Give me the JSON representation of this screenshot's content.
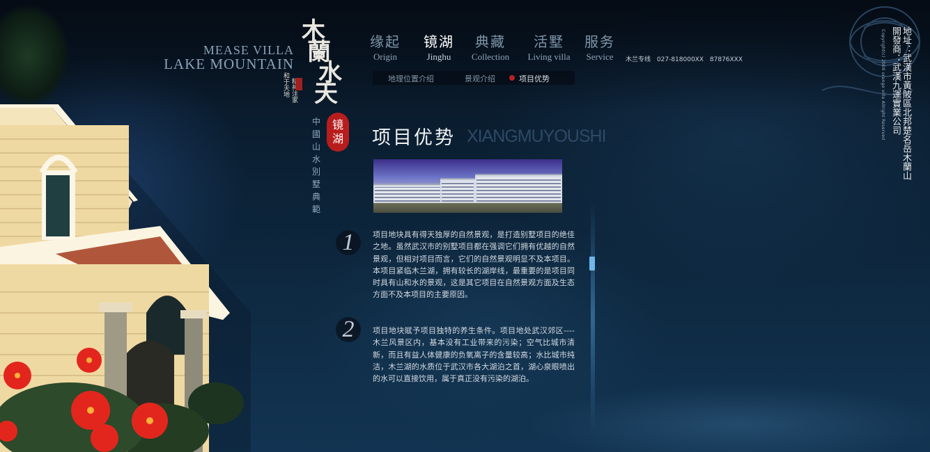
{
  "brand": {
    "en_line1": "MEASE VILLA",
    "en_line2": "LAKE MOUNTAIN",
    "cn_chars": [
      "木",
      "蘭",
      "水",
      "天"
    ],
    "small_left": "和于天地",
    "small_right": "精神注家",
    "mirror_seal": [
      "镜",
      "湖"
    ],
    "vertical_slogan": "中國山水別墅典範"
  },
  "nav": {
    "items": [
      {
        "cn": "缘起",
        "en": "Origin",
        "active": false
      },
      {
        "cn": "镜湖",
        "en": "Jinghu",
        "active": true
      },
      {
        "cn": "典藏",
        "en": "Collection",
        "active": false
      },
      {
        "cn": "活墅",
        "en": "Living villa",
        "active": false
      },
      {
        "cn": "服务",
        "en": "Service",
        "active": false
      }
    ],
    "hotline_label": "木兰专线",
    "hotline_numbers": [
      "027-818000XX",
      "87876XXX"
    ]
  },
  "subnav": {
    "items": [
      {
        "label": "地理位置介绍",
        "active": false
      },
      {
        "label": "景观介绍",
        "active": false
      },
      {
        "label": "项目优势",
        "active": true
      }
    ]
  },
  "content": {
    "title_cn": "项目优势",
    "title_en": "XIANGMUYOUSHI",
    "sections": [
      {
        "number": "1",
        "text": "项目地块具有得天独厚的自然景观，是打造别墅项目的绝佳之地。虽然武汉市的别墅项目都在强调它们拥有优越的自然景观，但相对项目而言，它们的自然景观明显不及本项目。本项目紧临木兰湖，拥有较长的湖岸线，最重要的是项目同时具有山和水的景观，这是其它项目在自然景观方面及生态方面不及本项目的主要原因。"
      },
      {
        "number": "2",
        "text": "项目地块赋予项目独特的养生条件。项目地处武汉郊区----木兰风景区内，基本没有工业带来的污染；空气比城市清新，而且有益人体健康的负氧离子的含量较高；水比城市纯洁，木兰湖的水质位于武汉市各大湖泊之首，湖心泉眼喷出的水可以直接饮用，属于真正没有污染的湖泊。"
      }
    ]
  },
  "side": {
    "address": "地址：武漢市黃陂區北邦楚名岳木蘭山",
    "developer": "開發商：武漢九運實業公司",
    "copyright": "Copyright(c) 2009 orange villa Allright Reserved"
  },
  "colors": {
    "background": "#0b2034",
    "seal_red": "#b81d1d",
    "accent_blue": "#6fb7ea"
  }
}
